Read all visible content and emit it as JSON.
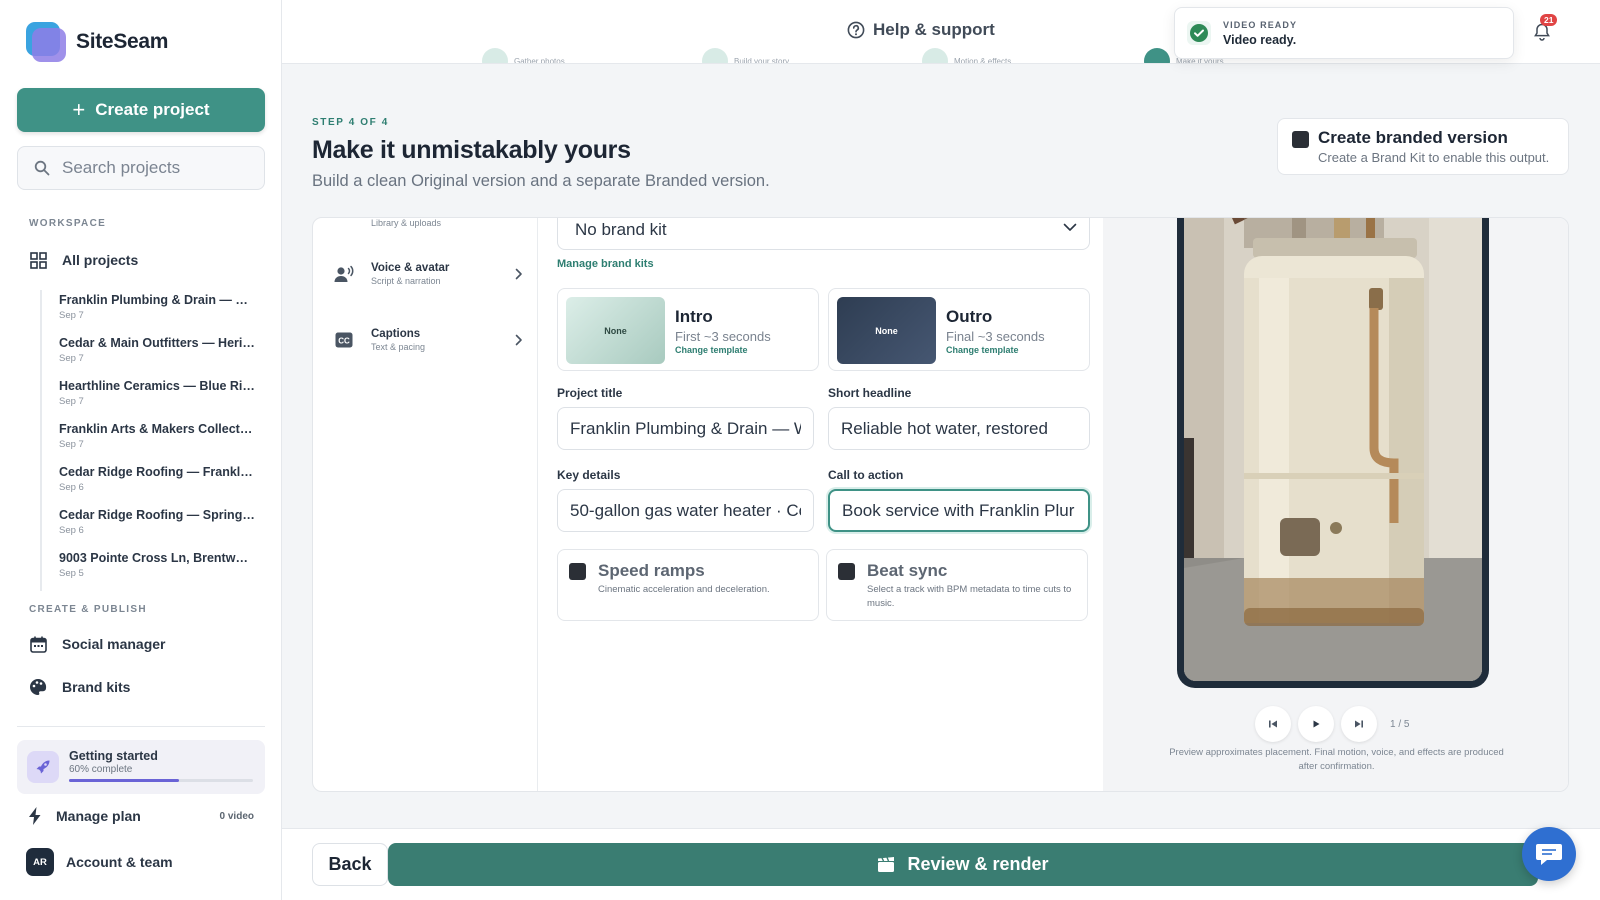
{
  "brand": {
    "name": "SiteSeam"
  },
  "sidebar": {
    "create_label": "Create project",
    "search_placeholder": "Search projects",
    "workspace_label": "WORKSPACE",
    "all_projects_label": "All projects",
    "projects": [
      {
        "title": "Franklin Plumbing & Drain — W...",
        "date": "Sep 7"
      },
      {
        "title": "Cedar & Main Outfitters — Herit...",
        "date": "Sep 7"
      },
      {
        "title": "Hearthline Ceramics — Blue Rid...",
        "date": "Sep 7"
      },
      {
        "title": "Franklin Arts & Makers Collectiv...",
        "date": "Sep 7"
      },
      {
        "title": "Cedar Ridge Roofing — Franklin ...",
        "date": "Sep 6"
      },
      {
        "title": "Cedar Ridge Roofing — Spring R...",
        "date": "Sep 6"
      },
      {
        "title": "9003 Pointe Cross Ln, Brentwoo...",
        "date": "Sep 5"
      }
    ],
    "create_publish_label": "CREATE & PUBLISH",
    "social_label": "Social manager",
    "brand_kits_label": "Brand kits",
    "getting_started": {
      "title": "Getting started",
      "progress_text": "60% complete",
      "progress": 0.6
    },
    "plan": {
      "label": "Manage plan",
      "value": "0 video"
    },
    "account": {
      "initials": "AR",
      "label": "Account & team"
    }
  },
  "topbar": {
    "help_label": "Help & support",
    "notifications_count": "21",
    "toast": {
      "kicker": "VIDEO READY",
      "message": "Video ready."
    }
  },
  "header": {
    "kicker": "STEP 4 OF 4",
    "title": "Make it unmistakably yours",
    "subtitle": "Build a clean Original version and a separate Branded version.",
    "branded": {
      "title": "Create branded version",
      "subtitle": "Create a Brand Kit to enable this output."
    }
  },
  "left_nav": {
    "partial_sub": "Library & uploads",
    "items": [
      {
        "title": "Voice & avatar",
        "sub": "Script & narration"
      },
      {
        "title": "Captions",
        "sub": "Text & pacing"
      }
    ]
  },
  "form": {
    "brand_kit_value": "No brand kit",
    "manage_link": "Manage brand kits",
    "intro": {
      "thumb": "None",
      "title": "Intro",
      "sub": "First ~3 seconds",
      "change": "Change template"
    },
    "outro": {
      "thumb": "None",
      "title": "Outro",
      "sub": "Final ~3 seconds",
      "change": "Change template"
    },
    "project_title": {
      "label": "Project title",
      "value": "Franklin Plumbing & Drain — W"
    },
    "headline": {
      "label": "Short headline",
      "value": "Reliable hot water, restored"
    },
    "key_details": {
      "label": "Key details",
      "value": "50-gallon gas water heater · Co"
    },
    "cta": {
      "label": "Call to action",
      "value": "Book service with Franklin Plur"
    },
    "speed_ramps": {
      "title": "Speed ramps",
      "sub": "Cinematic acceleration and deceleration."
    },
    "beat_sync": {
      "title": "Beat sync",
      "sub": "Select a track with BPM metadata to time cuts to music."
    }
  },
  "preview": {
    "counter": "1 / 5",
    "note": "Preview approximates placement. Final motion, voice, and effects are produced after confirmation."
  },
  "footer": {
    "back_label": "Back",
    "render_label": "Review & render"
  },
  "colors": {
    "accent": "#3f9286",
    "render": "#3a7d72",
    "chat": "#2f6fd1",
    "progress": "#6a63d6"
  }
}
